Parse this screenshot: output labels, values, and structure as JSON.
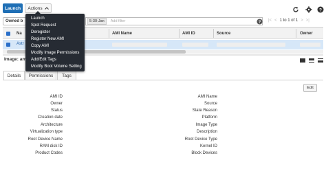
{
  "toolbar": {
    "launch_label": "Launch",
    "actions_label": "Actions",
    "refresh_icon": "refresh-icon",
    "settings_icon": "gear-icon",
    "help_icon": "help-icon"
  },
  "filter": {
    "owned_by_label": "Owned b",
    "date_chip": "5-30-Jan",
    "placeholder": "Add filter",
    "pagination": "1 to 1 of 1"
  },
  "table": {
    "columns": [
      "Na",
      "AMI Name",
      "AMI ID",
      "Source",
      "Owner"
    ],
    "rows": [
      {
        "name": "Astr"
      }
    ]
  },
  "actions_menu": {
    "items": [
      "Launch",
      "Spot Request",
      "Deregister",
      "Register New AMI",
      "Copy AMI",
      "Modify Image Permissions",
      "Add/Edit Tags",
      "Modify Boot Volume Setting"
    ]
  },
  "details": {
    "title": "Image: ami",
    "tabs": [
      "Details",
      "Permissions",
      "Tags"
    ],
    "edit_label": "Edit",
    "left_fields": [
      "AMI ID",
      "Owner",
      "Status",
      "Creation date",
      "Architecture",
      "Virtualization type",
      "Root Device Name",
      "RAM disk ID",
      "Product Codes"
    ],
    "right_fields": [
      "AMI Name",
      "Source",
      "State Reason",
      "Platform",
      "Image Type",
      "Description",
      "Root Device Type",
      "Kernel ID",
      "Block Devices"
    ]
  },
  "colors": {
    "primary": "#1f6fb5",
    "menu_bg": "#262b33",
    "selected_row": "#d6e7f8"
  }
}
